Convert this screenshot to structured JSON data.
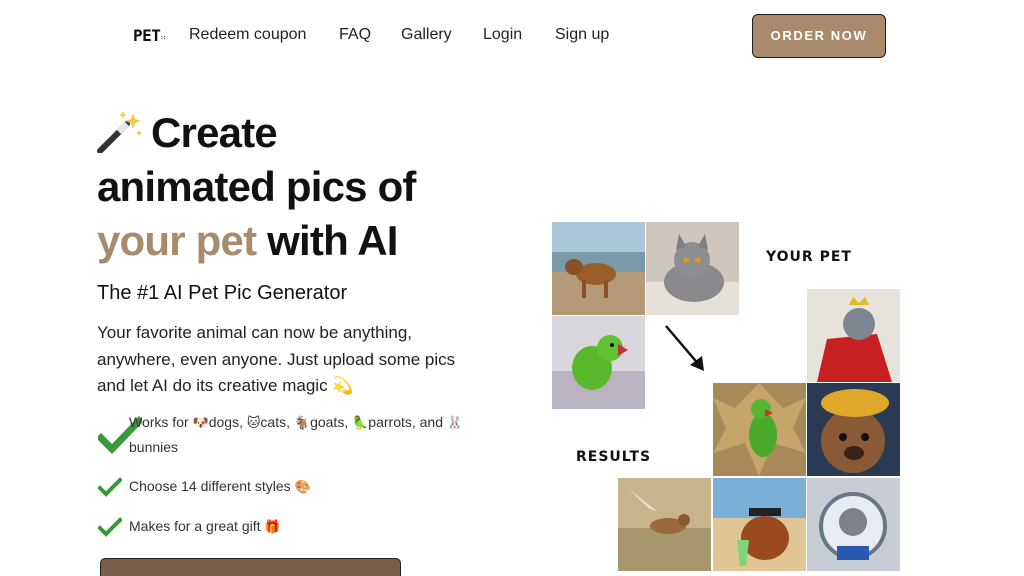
{
  "nav": {
    "logo": "PET",
    "logo_small": "::",
    "links": [
      "Redeem coupon",
      "FAQ",
      "Gallery",
      "Login",
      "Sign up"
    ],
    "cta": "ORDER NOW"
  },
  "hero": {
    "title_line1": "Create",
    "title_line2": "animated pics of",
    "title_accent": "your pet",
    "title_rest": " with AI",
    "subtitle": "The #1 AI Pet Pic Generator",
    "description": "Your favorite animal can now be anything, anywhere, even anyone. Just upload some pics and let AI do its creative magic",
    "description_emoji": "💫"
  },
  "features": [
    {
      "text_parts": [
        "Works for ",
        "🐶",
        "dogs, ",
        "🐱",
        "cats, ",
        "🐐",
        "goats, ",
        "🦜",
        "parrots, and ",
        "🐰",
        "bunnies"
      ]
    },
    {
      "text_parts": [
        "Choose 14 different styles ",
        "🎨"
      ]
    },
    {
      "text_parts": [
        "Makes for a great gift ",
        "🎁"
      ]
    }
  ],
  "gallery": {
    "label_input": "YOUR PET",
    "label_output": "RESULTS"
  },
  "colors": {
    "accent": "#a88a6c",
    "check": "#3a9a3a",
    "text": "#111111"
  },
  "icons": [
    "magic-wand-icon",
    "check-icon",
    "arrow-down-right-icon"
  ]
}
